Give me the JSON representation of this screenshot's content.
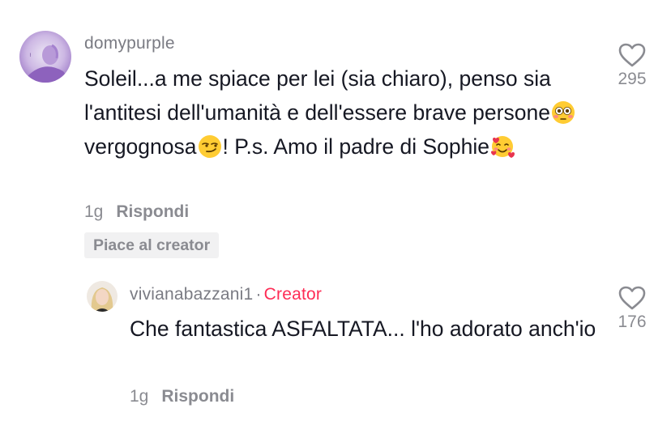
{
  "comment": {
    "username": "domypurple",
    "text_parts": [
      "Soleil...a me spiace per lei (sia chiaro), penso sia l'antitesi dell'umanità e dell'essere brave persone",
      " vergognosa",
      "! P.s. Amo il padre di Sophie"
    ],
    "time": "1g",
    "reply_label": "Rispondi",
    "liked_by_creator": "Piace al creator",
    "likes": "295",
    "emoji_names": [
      "flushed-face",
      "smirking-face",
      "smiling-face-with-hearts"
    ]
  },
  "reply": {
    "username": "vivianabazzani1",
    "separator": "·",
    "badge": "Creator",
    "text": "Che fantastica ASFALTATA... l'ho adorato anch'io",
    "time": "1g",
    "reply_label": "Rispondi",
    "likes": "176"
  },
  "colors": {
    "creator_badge": "#fe2c55",
    "muted_text": "#8a8b91",
    "primary_text": "#161823"
  }
}
